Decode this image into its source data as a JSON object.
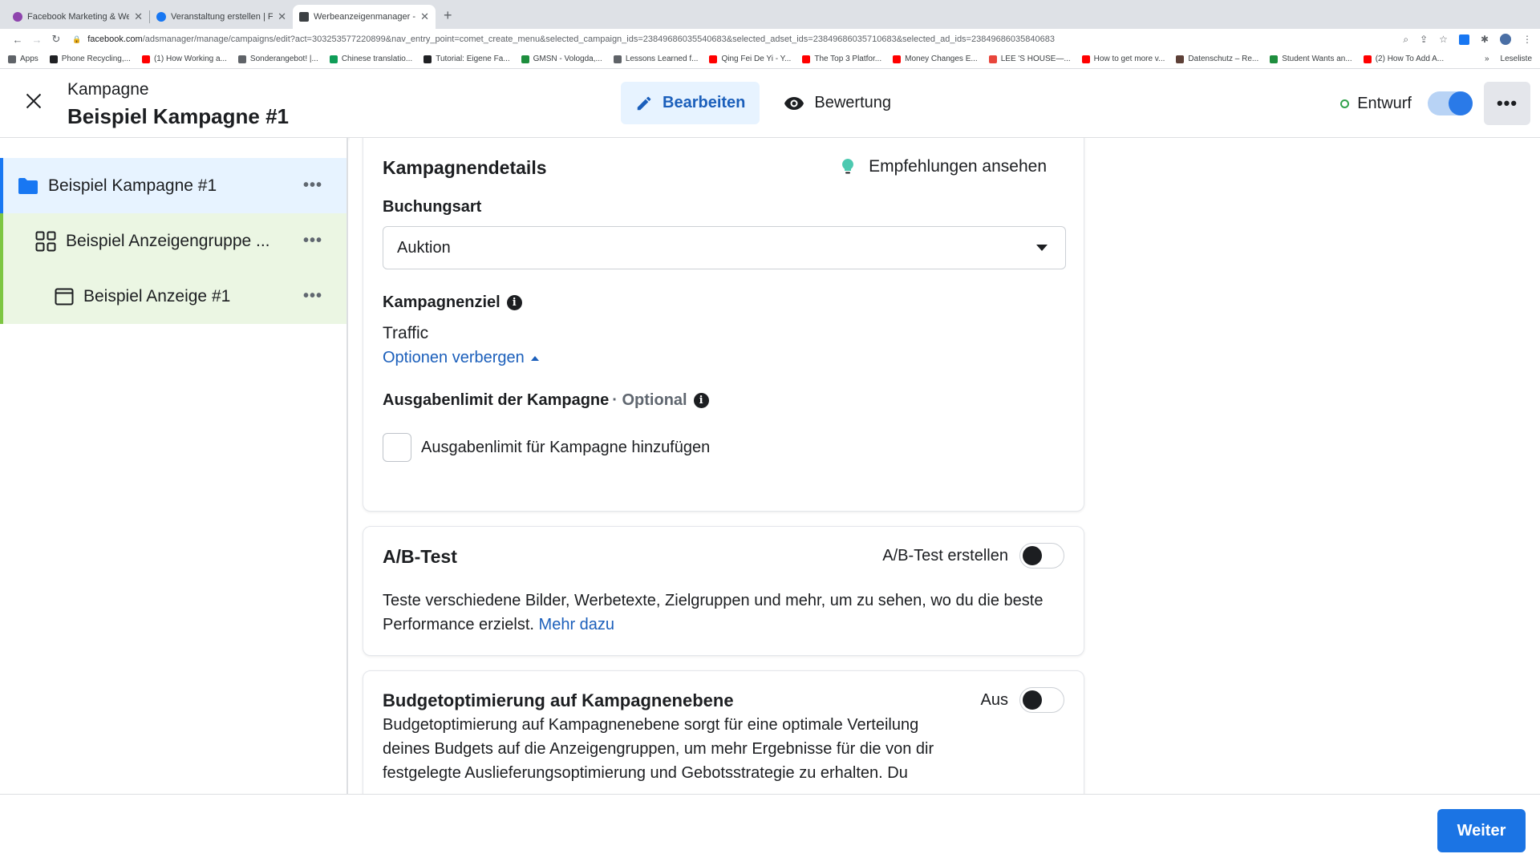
{
  "browser": {
    "tabs": [
      {
        "title": "Facebook Marketing & Werbea",
        "color": "#8e44ad",
        "active": false
      },
      {
        "title": "Veranstaltung erstellen | Faceb",
        "color": "#1877f2",
        "active": false
      },
      {
        "title": "Werbeanzeigenmanager - Wer",
        "color": "#3c4043",
        "active": true
      }
    ],
    "url_domain": "facebook.com",
    "url_path": "/adsmanager/manage/campaigns/edit?act=303253577220899&nav_entry_point=comet_create_menu&selected_campaign_ids=23849686035540683&selected_adset_ids=23849686035710683&selected_ad_ids=23849686035840683",
    "bookmarks": [
      {
        "label": "Apps",
        "color": "#5f6368"
      },
      {
        "label": "Phone Recycling,...",
        "color": "#202124"
      },
      {
        "label": "(1) How Working a...",
        "color": "#ff0000"
      },
      {
        "label": "Sonderangebot! |...",
        "color": "#5f6368"
      },
      {
        "label": "Chinese translatio...",
        "color": "#0f9d58"
      },
      {
        "label": "Tutorial: Eigene Fa...",
        "color": "#202124"
      },
      {
        "label": "GMSN - Vologda,...",
        "color": "#1e8e3e"
      },
      {
        "label": "Lessons Learned f...",
        "color": "#5f6368"
      },
      {
        "label": "Qing Fei De Yi - Y...",
        "color": "#ff0000"
      },
      {
        "label": "The Top 3 Platfor...",
        "color": "#ff0000"
      },
      {
        "label": "Money Changes E...",
        "color": "#ff0000"
      },
      {
        "label": "LEE 'S HOUSE—...",
        "color": "#e8453c"
      },
      {
        "label": "How to get more v...",
        "color": "#ff0000"
      },
      {
        "label": "Datenschutz – Re...",
        "color": "#5d4037"
      },
      {
        "label": "Student Wants an...",
        "color": "#1e8e3e"
      },
      {
        "label": "(2) How To Add A...",
        "color": "#ff0000"
      }
    ],
    "bookmarks_more": "»",
    "reading_list": "Leseliste"
  },
  "header": {
    "subtitle": "Kampagne",
    "title": "Beispiel Kampagne #1",
    "edit_label": "Bearbeiten",
    "review_label": "Bewertung",
    "status_label": "Entwurf",
    "more_label": "•••"
  },
  "sidebar": {
    "items": [
      {
        "label": "Beispiel Kampagne #1",
        "more": "•••"
      },
      {
        "label": "Beispiel Anzeigengruppe ...",
        "more": "•••"
      },
      {
        "label": "Beispiel Anzeige #1",
        "more": "•••"
      }
    ]
  },
  "campaign_details": {
    "title": "Kampagnendetails",
    "recommendations_label": "Empfehlungen ansehen",
    "buying_type_label": "Buchungsart",
    "buying_type_value": "Auktion",
    "objective_label": "Kampagnenziel",
    "objective_value": "Traffic",
    "options_link": "Optionen verbergen",
    "spend_limit_label": "Ausgabenlimit der Kampagne",
    "spend_limit_optional": "· Optional",
    "spend_limit_checkbox_label": "Ausgabenlimit für Kampagne hinzufügen"
  },
  "ab_test": {
    "title": "A/B-Test",
    "toggle_label": "A/B-Test erstellen",
    "description": "Teste verschiedene Bilder, Werbetexte, Zielgruppen und mehr, um zu sehen, wo du die beste",
    "description_line2": "Performance erzielst.",
    "learn_more": "Mehr dazu"
  },
  "budget_optimization": {
    "title": "Budgetoptimierung auf Kampagnenebene",
    "toggle_label": "Aus",
    "description_lines": [
      "Budgetoptimierung auf Kampagnenebene sorgt für eine optimale Verteilung",
      "deines Budgets auf die Anzeigengruppen, um mehr Ergebnisse für die von dir",
      "festgelegte Auslieferungsoptimierung und Gebotsstrategie zu erhalten. Du"
    ]
  },
  "footer": {
    "next_label": "Weiter"
  },
  "colors": {
    "accent": "#1877f2",
    "link": "#1b5fbb",
    "adset_green": "#7dc642",
    "status_green": "#31a24c"
  }
}
